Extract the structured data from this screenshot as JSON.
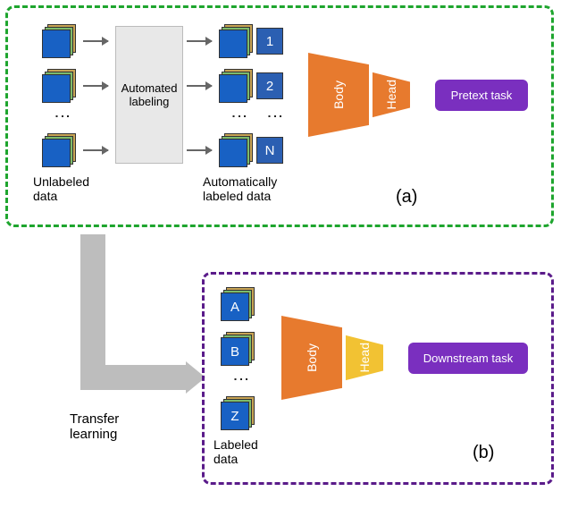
{
  "panelA": {
    "unlabeled_caption": "Unlabeled\ndata",
    "labeled_caption": "Automatically\nlabeled data",
    "automated_box": "Automated\nlabeling",
    "labels": [
      "1",
      "2",
      "N"
    ],
    "body": "Body",
    "head": "Head",
    "task": "Pretext task",
    "tag": "(a)"
  },
  "panelB": {
    "labeled_caption": "Labeled\ndata",
    "labels": [
      "A",
      "B",
      "Z"
    ],
    "body": "Body",
    "head": "Head",
    "task": "Downstream task",
    "tag": "(b)"
  },
  "transfer": "Transfer\nlearning",
  "colors": {
    "orange": "#e77a2e",
    "yellow": "#f2c233",
    "purple": "#7a2fbf",
    "blue": "#2b5fb2"
  }
}
